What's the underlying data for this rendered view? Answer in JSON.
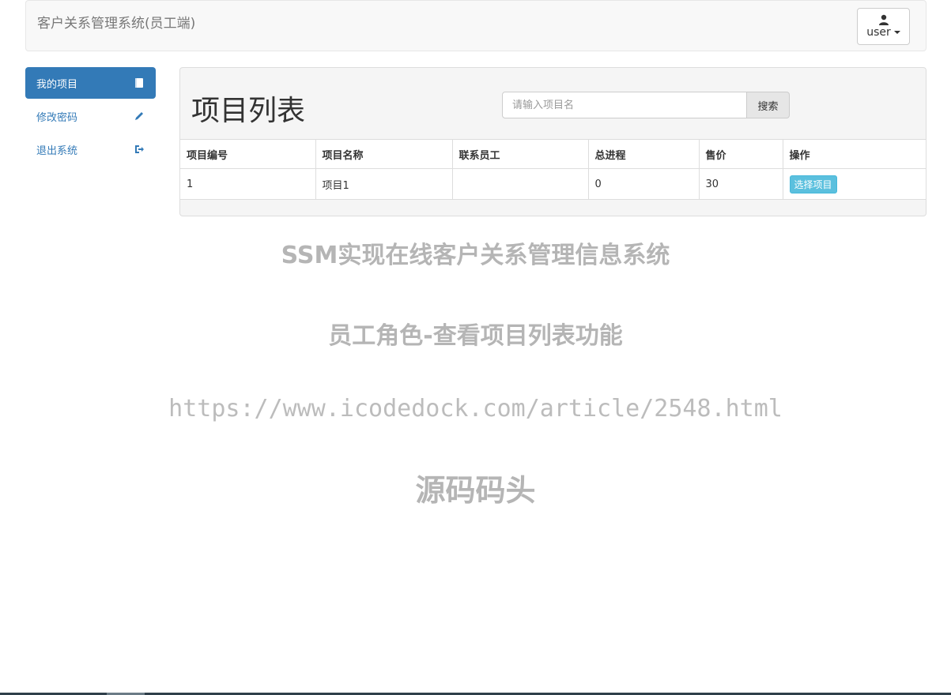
{
  "navbar": {
    "brand": "客户关系管理系统(员工端)",
    "user_label": "user"
  },
  "sidebar": {
    "items": [
      {
        "label": "我的项目",
        "icon": "book-icon",
        "active": true
      },
      {
        "label": "修改密码",
        "icon": "pencil-icon",
        "active": false
      },
      {
        "label": "退出系统",
        "icon": "logout-icon",
        "active": false
      }
    ]
  },
  "main": {
    "title": "项目列表",
    "search": {
      "placeholder": "请输入项目名",
      "button": "搜索"
    },
    "table": {
      "headers": [
        "项目编号",
        "项目名称",
        "联系员工",
        "总进程",
        "售价",
        "操作"
      ],
      "rows": [
        {
          "id": "1",
          "name": "项目1",
          "employee": "",
          "progress": "0",
          "price": "30",
          "action": "选择项目"
        }
      ]
    }
  },
  "watermark": {
    "line1": "SSM实现在线客户关系管理信息系统",
    "line2": "员工角色-查看项目列表功能",
    "line3": "https://www.icodedock.com/article/2548.html",
    "line4": "源码码头"
  },
  "colors": {
    "primary": "#337ab7",
    "info": "#5bc0de",
    "watermark": "#b5b5b5"
  }
}
